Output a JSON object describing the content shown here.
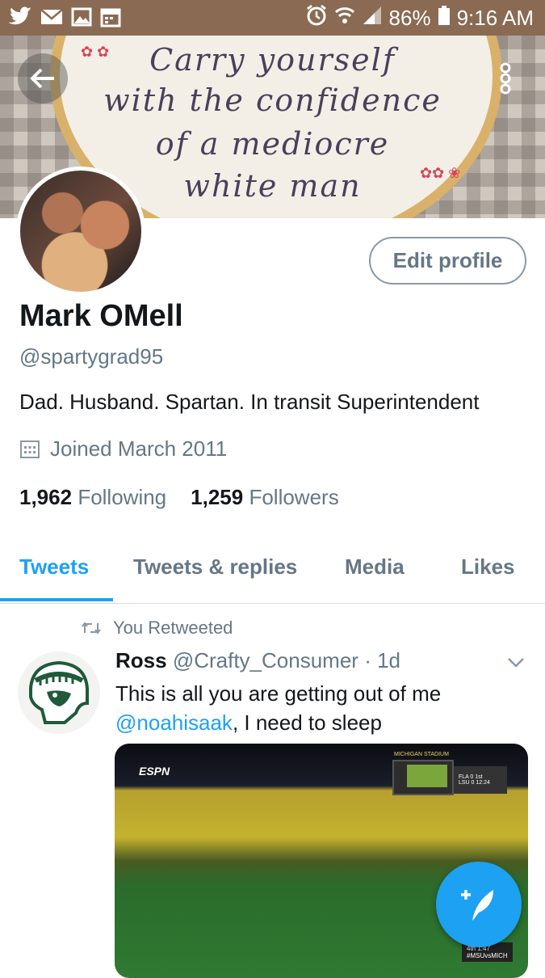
{
  "status_bar": {
    "battery": "86%",
    "time": "9:16 AM",
    "left_icons": [
      "twitter-icon",
      "mail-icon",
      "gallery-icon",
      "calendar-icon"
    ],
    "right_icons": [
      "alarm-icon",
      "wifi-icon",
      "signal-icon",
      "battery-icon"
    ]
  },
  "banner": {
    "lines": [
      "Carry yourself",
      "with the confidence",
      "of a mediocre",
      "white man"
    ]
  },
  "profile": {
    "name": "Mark OMell",
    "handle": "@spartygrad95",
    "bio": "Dad. Husband. Spartan. In transit Superintendent",
    "joined": "Joined March 2011",
    "following_count": "1,962",
    "following_label": "Following",
    "followers_count": "1,259",
    "followers_label": "Followers",
    "edit_button": "Edit profile"
  },
  "tabs": [
    {
      "label": "Tweets",
      "active": true
    },
    {
      "label": "Tweets & replies",
      "active": false
    },
    {
      "label": "Media",
      "active": false
    },
    {
      "label": "Likes",
      "active": false
    }
  ],
  "tweet": {
    "retweet_label": "You Retweeted",
    "author_name": "Ross",
    "author_handle": "@Crafty_Consumer",
    "separator": "·",
    "time": "1d",
    "text_part1": "This is all you are getting out of me",
    "mention": "@noahisaak",
    "text_part2": ", I need to sleep",
    "media": {
      "network": "ESPN",
      "stadium_sign": "MICHIGAN STADIUM",
      "score_rows": [
        "FLA 0 1st",
        "LSU 0 12:24"
      ],
      "corner_score_quarter": "4th 1:47",
      "corner_score_tag": "#MSUvsMICH"
    }
  },
  "colors": {
    "accent": "#1da1f2",
    "status_bar": "#8a6a52",
    "muted": "#657786"
  }
}
